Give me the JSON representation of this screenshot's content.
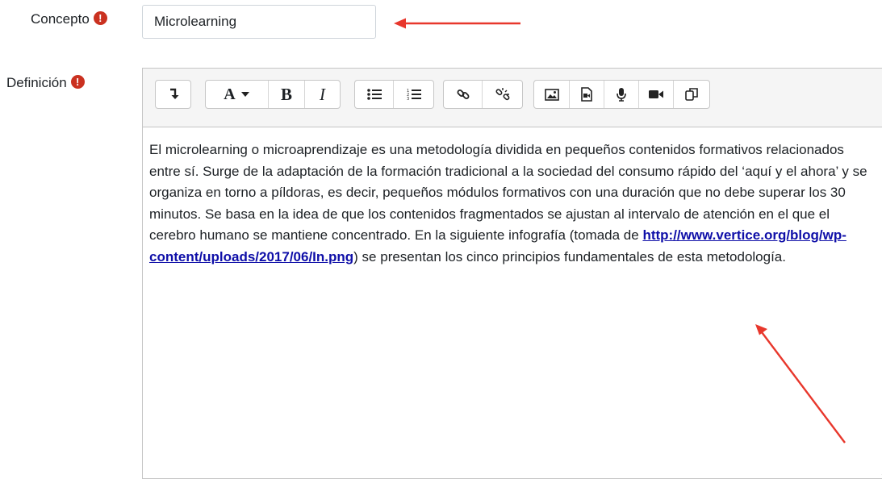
{
  "concept": {
    "label": "Concepto",
    "required_icon": "exclamation-circle-icon",
    "value": "Microlearning"
  },
  "definition": {
    "label": "Definición",
    "required_icon": "exclamation-circle-icon",
    "text_part1": "El microlearning o microaprendizaje es una metodología dividida en pequeños contenidos formativos relacionados entre sí. Surge de la adaptación de la formación tradicional a la sociedad del consumo rápido del ‘aquí y el ahora’ y se organiza en torno a píldoras, es decir, pequeños módulos formativos con una duración que no debe superar los 30 minutos. Se basa en la idea de que los contenidos fragmentados se ajustan al intervalo de atención en el que el cerebro humano se mantiene concentrado. En la siguiente infografía (tomada de ",
    "link_text": "http://www.vertice.org/blog/wp-content/uploads/2017/06/In.png",
    "text_part2": ") se presentan los cinco principios fundamentales de esta metodología."
  },
  "toolbar": {
    "groups": [
      [
        "toolbar-toggle-icon"
      ],
      [
        "font-style-dropdown-icon",
        "bold-icon",
        "italic-icon"
      ],
      [
        "unordered-list-icon",
        "ordered-list-icon"
      ],
      [
        "link-icon",
        "unlink-icon"
      ],
      [
        "image-icon",
        "media-icon",
        "microphone-icon",
        "video-camera-icon",
        "copy-icon"
      ]
    ]
  },
  "colors": {
    "required": "#ca3120",
    "annotation_arrow": "#e8372c",
    "link": "#0f0fa8"
  }
}
